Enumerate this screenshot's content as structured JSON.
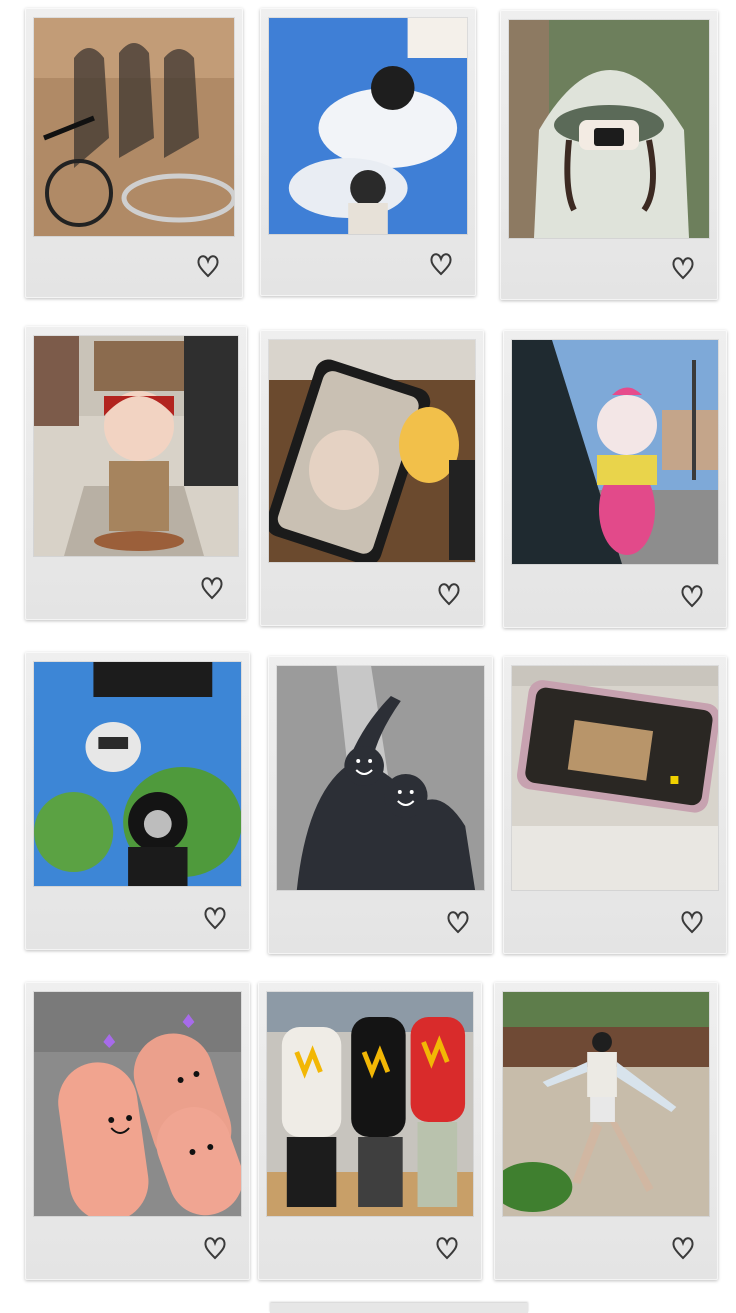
{
  "gallery": {
    "cards": [
      {
        "photo": "shadow-bicycle-group",
        "icon": "heart-icon"
      },
      {
        "photo": "sky-selfie-helmet",
        "icon": "heart-icon"
      },
      {
        "photo": "hoodie-camera-selfie",
        "icon": "heart-icon"
      },
      {
        "photo": "dinosaur-figure",
        "icon": "heart-icon"
      },
      {
        "photo": "phone-drinks",
        "icon": "heart-icon"
      },
      {
        "photo": "pink-mascot-street",
        "icon": "heart-icon"
      },
      {
        "photo": "upside-down-trees",
        "icon": "heart-icon"
      },
      {
        "photo": "shadow-smiley-faces",
        "icon": "heart-icon"
      },
      {
        "photo": "phone-camera-screen",
        "icon": "heart-icon"
      },
      {
        "photo": "finger-faces",
        "icon": "heart-icon"
      },
      {
        "photo": "hoodie-group-store",
        "icon": "heart-icon"
      },
      {
        "photo": "dancing-girl-park",
        "icon": "heart-icon"
      }
    ]
  },
  "colors": {
    "frame": "#e8e8e8",
    "heart_stroke": "#3a3a3a",
    "background": "#ffffff"
  }
}
